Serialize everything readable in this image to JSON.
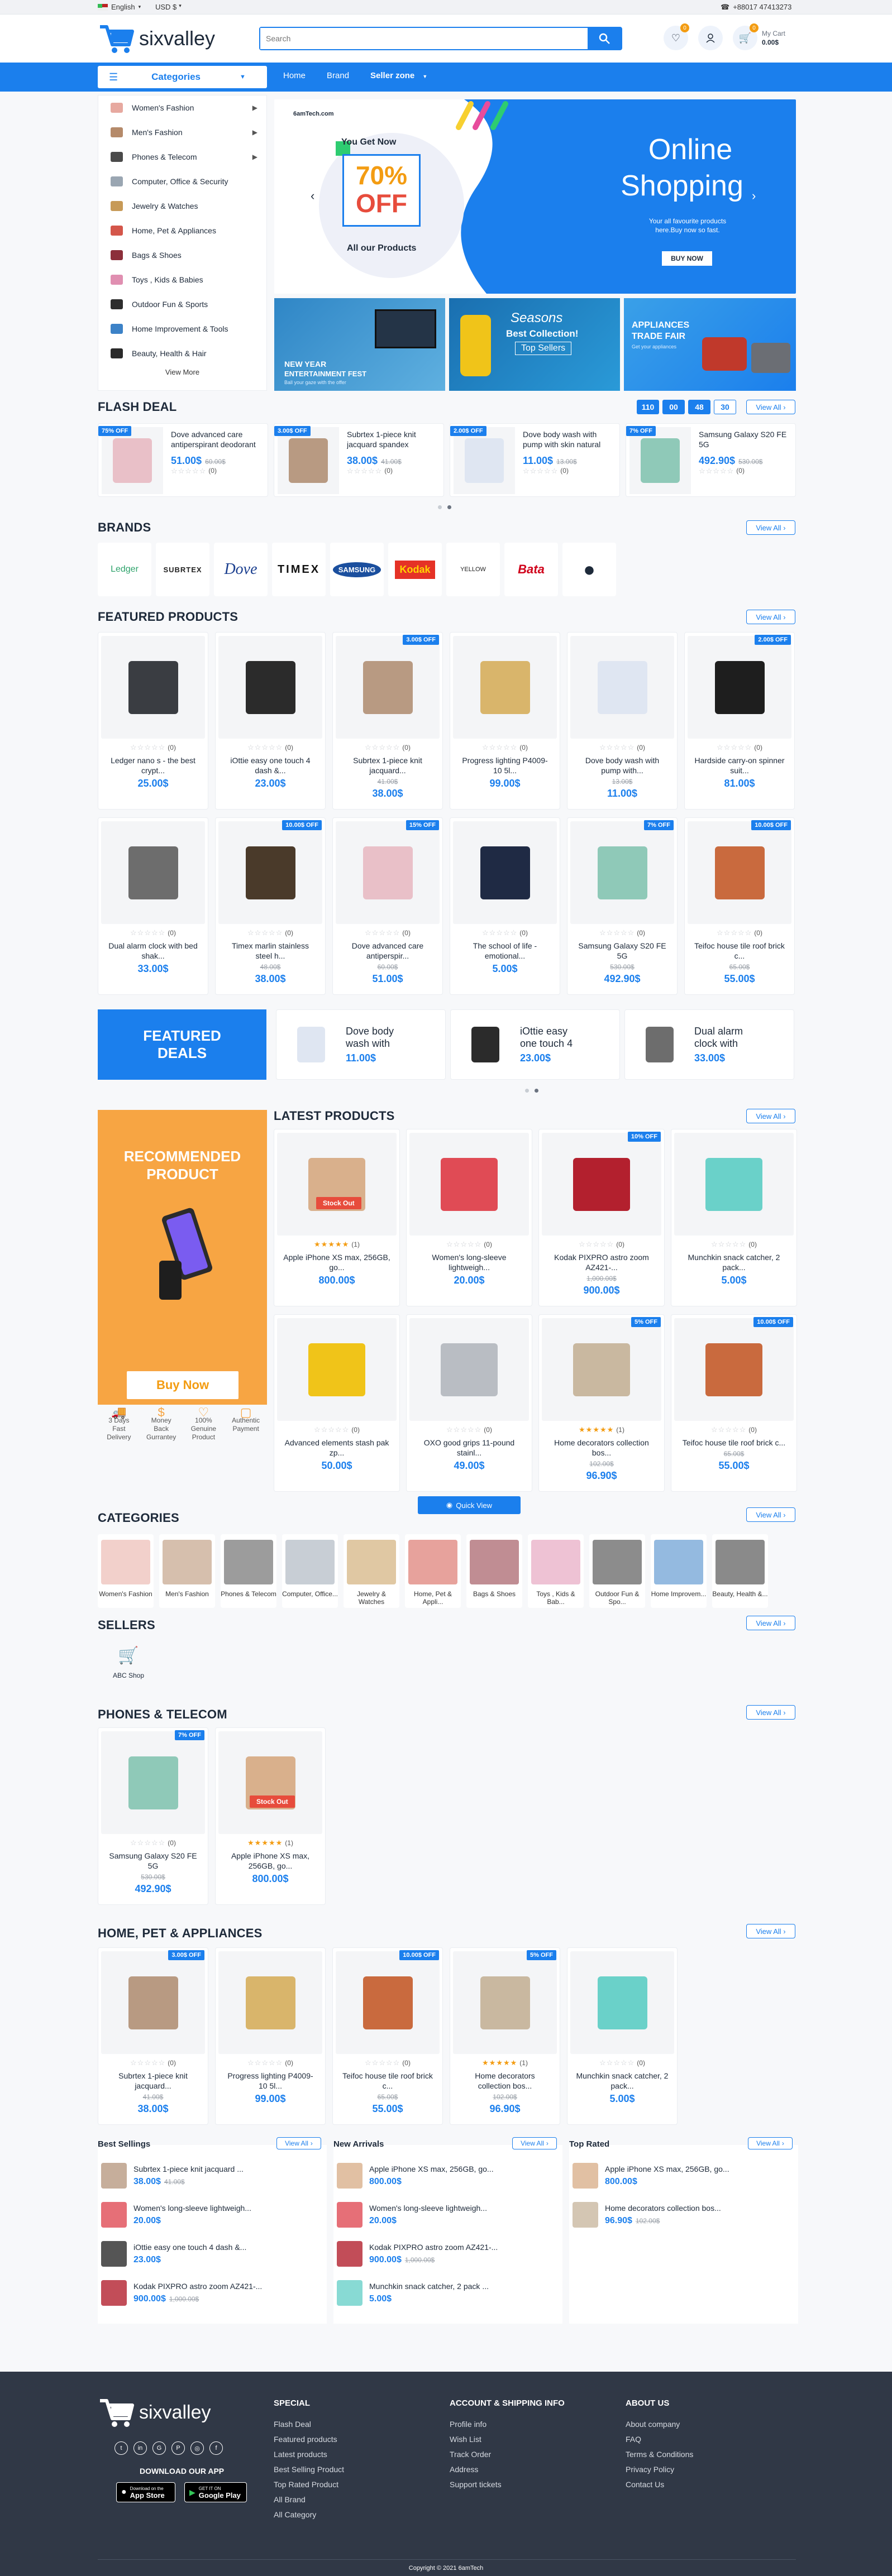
{
  "topbar": {
    "language": "English",
    "currency": "USD $",
    "phone": "+88017 47413273"
  },
  "header": {
    "logo": "sixvalley",
    "search_placeholder": "Search",
    "wishlist_count": "0",
    "compare_count": "0",
    "cart_label": "My Cart",
    "cart_total": "0.00$",
    "cart_count": "0"
  },
  "nav": {
    "categories_label": "Categories",
    "items": [
      "Home",
      "Brand",
      "Seller zone"
    ]
  },
  "sidebar": {
    "items": [
      {
        "label": "Women's Fashion",
        "color": "#e7a9a0",
        "arrow": true
      },
      {
        "label": "Men's Fashion",
        "color": "#b58a6a",
        "arrow": true
      },
      {
        "label": "Phones & Telecom",
        "color": "#4a4a4a",
        "arrow": true
      },
      {
        "label": "Computer, Office & Security",
        "color": "#9aa6b2",
        "arrow": false
      },
      {
        "label": "Jewelry & Watches",
        "color": "#c79a57",
        "arrow": false
      },
      {
        "label": "Home, Pet & Appliances",
        "color": "#d4564a",
        "arrow": false
      },
      {
        "label": "Bags & Shoes",
        "color": "#8c2f3a",
        "arrow": false
      },
      {
        "label": "Toys , Kids & Babies",
        "color": "#e08fb1",
        "arrow": false
      },
      {
        "label": "Outdoor Fun & Sports",
        "color": "#2d2d2d",
        "arrow": false
      },
      {
        "label": "Home Improvement & Tools",
        "color": "#3c82c7",
        "arrow": false
      },
      {
        "label": "Beauty, Health & Hair",
        "color": "#2a2a2a",
        "arrow": false
      }
    ],
    "view_more": "View More"
  },
  "hero": {
    "site": "6amTech.com",
    "you_get_now": "You Get Now",
    "discount": "70%",
    "off": "OFF",
    "all_products": "All our Products",
    "headline1": "Online",
    "headline2": "Shopping",
    "sub": "Your all favourite products here.Buy now so fast.",
    "cta": "BUY NOW"
  },
  "banners": [
    {
      "l1": "NEW YEAR",
      "l2": "ENTERTAINMENT FEST",
      "l3": "Ball your gaze with the offer"
    },
    {
      "l1": "Seasons",
      "l2": "Best Collection!",
      "l3": "Top Sellers"
    },
    {
      "l1": "APPLIANCES",
      "l2": "TRADE FAIR",
      "l3": "Get your appliances"
    }
  ],
  "flash_deal": {
    "title": "FLASH DEAL",
    "timer": [
      "110",
      "00",
      "48",
      "30"
    ],
    "view_all": "View All",
    "items": [
      {
        "badge": "75% OFF",
        "name": "Dove advanced care antiperspirant deodorant",
        "price": "51.00$",
        "old": "60.00$",
        "rating": "(0)",
        "color": "#e9c0c8"
      },
      {
        "badge": "3.00$ OFF",
        "name": "Subrtex 1-piece knit jacquard spandex stretch...",
        "price": "38.00$",
        "old": "41.00$",
        "rating": "(0)",
        "color": "#b89a82"
      },
      {
        "badge": "2.00$ OFF",
        "name": "Dove body wash with pump with skin natural",
        "price": "11.00$",
        "old": "13.00$",
        "rating": "(0)",
        "color": "#dfe6f2"
      },
      {
        "badge": "7% OFF",
        "name": "Samsung Galaxy S20 FE 5G",
        "price": "492.90$",
        "old": "530.00$",
        "rating": "(0)",
        "color": "#8fc9b8"
      }
    ]
  },
  "brands": {
    "title": "BRANDS",
    "view_all": "View All",
    "items": [
      "Ledger",
      "SUBRTEX",
      "Dove",
      "TIMEX",
      "SAMSUNG",
      "Kodak",
      "YELLOW",
      "Bata",
      "Apple"
    ]
  },
  "featured": {
    "title": "FEATURED PRODUCTS",
    "view_all": "View All",
    "items": [
      {
        "badge": "",
        "name": "Ledger nano s - the best crypt...",
        "price": "25.00$",
        "old": "",
        "color": "#3a3d42"
      },
      {
        "badge": "",
        "name": "iOttie easy one touch 4 dash &...",
        "price": "23.00$",
        "old": "",
        "color": "#2b2b2b"
      },
      {
        "badge": "3.00$ OFF",
        "name": "Subrtex 1-piece knit jacquard...",
        "price": "38.00$",
        "old": "41.00$",
        "color": "#b89a82"
      },
      {
        "badge": "",
        "name": "Progress lighting P4009-10 5l...",
        "price": "99.00$",
        "old": "",
        "color": "#d9b56b"
      },
      {
        "badge": "",
        "name": "Dove body wash with pump with...",
        "price": "11.00$",
        "old": "13.00$",
        "color": "#dfe6f2"
      },
      {
        "badge": "2.00$ OFF",
        "name": "Hardside carry-on spinner suit...",
        "price": "81.00$",
        "old": "",
        "color": "#1e1e1e"
      },
      {
        "badge": "",
        "name": "Dual alarm clock with bed shak...",
        "price": "33.00$",
        "old": "",
        "color": "#6d6d6d"
      },
      {
        "badge": "10.00$ OFF",
        "name": "Timex marlin stainless steel h...",
        "price": "38.00$",
        "old": "48.00$",
        "color": "#4a3a2a"
      },
      {
        "badge": "15% OFF",
        "name": "Dove advanced care antiperspir...",
        "price": "51.00$",
        "old": "60.00$",
        "color": "#e9c0c8"
      },
      {
        "badge": "",
        "name": "The school of life - emotional...",
        "price": "5.00$",
        "old": "",
        "color": "#1f2a44"
      },
      {
        "badge": "7% OFF",
        "name": "Samsung Galaxy S20 FE 5G",
        "price": "492.90$",
        "old": "530.00$",
        "color": "#8fc9b8"
      },
      {
        "badge": "10.00$ OFF",
        "name": "Teifoc house tile roof brick c...",
        "price": "55.00$",
        "old": "65.00$",
        "color": "#c96a3e"
      }
    ]
  },
  "featured_deals": {
    "title1": "FEATURED",
    "title2": "DEALS",
    "items": [
      {
        "name1": "Dove body",
        "name2": "wash with",
        "price": "11.00$",
        "color": "#dfe6f2"
      },
      {
        "name1": "iOttie easy",
        "name2": "one touch 4",
        "price": "23.00$",
        "color": "#2b2b2b"
      },
      {
        "name1": "Dual alarm",
        "name2": "clock with",
        "price": "33.00$",
        "color": "#6d6d6d"
      }
    ]
  },
  "recommended": {
    "title1": "RECOMMENDED",
    "title2": "PRODUCT",
    "cta": "Buy Now",
    "features": [
      {
        "l1": "3 Days",
        "l2": "Fast",
        "l3": "Delivery"
      },
      {
        "l1": "Money",
        "l2": "Back",
        "l3": "Gurrantey"
      },
      {
        "l1": "100%",
        "l2": "Genuine",
        "l3": "Product"
      },
      {
        "l1": "Authentic",
        "l2": "Payment",
        "l3": ""
      }
    ]
  },
  "latest": {
    "title": "LATEST PRODUCTS",
    "view_all": "View All",
    "quick_view": "Quick View",
    "items": [
      {
        "badge": "",
        "stock": "Stock Out",
        "name": "Apple iPhone XS max, 256GB, go...",
        "price": "800.00$",
        "old": "",
        "rated": true,
        "rating": "(1)",
        "color": "#d9b08c"
      },
      {
        "badge": "",
        "stock": "",
        "name": "Women's long-sleeve lightweigh...",
        "price": "20.00$",
        "old": "",
        "rated": false,
        "rating": "(0)",
        "color": "#e04b55"
      },
      {
        "badge": "10% OFF",
        "stock": "",
        "name": "Kodak PIXPRO astro zoom AZ421-...",
        "price": "900.00$",
        "old": "1,000.00$",
        "rated": false,
        "rating": "(0)",
        "color": "#b3202e"
      },
      {
        "badge": "",
        "stock": "",
        "name": "Munchkin snack catcher, 2 pack...",
        "price": "5.00$",
        "old": "",
        "rated": false,
        "rating": "(0)",
        "color": "#6ad1c9"
      },
      {
        "badge": "",
        "stock": "",
        "name": "Advanced elements stash pak zp...",
        "price": "50.00$",
        "old": "",
        "rated": false,
        "rating": "(0)",
        "color": "#f0c419"
      },
      {
        "badge": "",
        "stock": "",
        "name": "OXO good grips 11-pound stainl...",
        "price": "49.00$",
        "old": "",
        "rated": false,
        "rating": "(0)",
        "color": "#b9bdc3"
      },
      {
        "badge": "5% OFF",
        "stock": "",
        "name": "Home decorators collection bos...",
        "price": "96.90$",
        "old": "102.00$",
        "rated": true,
        "rating": "(1)",
        "color": "#c9b8a0"
      },
      {
        "badge": "10.00$ OFF",
        "stock": "",
        "name": "Teifoc house tile roof brick c...",
        "price": "55.00$",
        "old": "65.00$",
        "rated": false,
        "rating": "(0)",
        "color": "#c96a3e"
      }
    ]
  },
  "categories": {
    "title": "CATEGORIES",
    "view_all": "View All",
    "items": [
      {
        "label": "Women's Fashion",
        "color": "#e7a9a0"
      },
      {
        "label": "Men's Fashion",
        "color": "#b58a6a"
      },
      {
        "label": "Phones & Telecom",
        "color": "#4a4a4a"
      },
      {
        "label": "Computer, Office...",
        "color": "#9aa6b2"
      },
      {
        "label": "Jewelry & Watches",
        "color": "#c79a57"
      },
      {
        "label": "Home, Pet & Appli...",
        "color": "#d4564a"
      },
      {
        "label": "Bags & Shoes",
        "color": "#8c2f3a"
      },
      {
        "label": "Toys , Kids & Bab...",
        "color": "#e08fb1"
      },
      {
        "label": "Outdoor Fun & Spo...",
        "color": "#2d2d2d"
      },
      {
        "label": "Home Improvem...",
        "color": "#3c82c7"
      },
      {
        "label": "Beauty, Health &...",
        "color": "#2a2a2a"
      }
    ]
  },
  "sellers": {
    "title": "SELLERS",
    "view_all": "View All",
    "items": [
      {
        "name": "ABC Shop"
      }
    ]
  },
  "phones": {
    "title": "PHONES & TELECOM",
    "view_all": "View All",
    "items": [
      {
        "badge": "7% OFF",
        "stock": "",
        "name": "Samsung Galaxy S20 FE 5G",
        "price": "492.90$",
        "old": "530.00$",
        "rated": false,
        "rating": "(0)",
        "color": "#8fc9b8"
      },
      {
        "badge": "",
        "stock": "Stock Out",
        "name": "Apple iPhone XS max, 256GB, go...",
        "price": "800.00$",
        "old": "",
        "rated": true,
        "rating": "(1)",
        "color": "#d9b08c"
      }
    ]
  },
  "home_pet": {
    "title": "HOME, PET & APPLIANCES",
    "view_all": "View All",
    "items": [
      {
        "badge": "3.00$ OFF",
        "name": "Subrtex 1-piece knit jacquard...",
        "price": "38.00$",
        "old": "41.00$",
        "rated": false,
        "rating": "(0)",
        "color": "#b89a82"
      },
      {
        "badge": "",
        "name": "Progress lighting P4009-10 5l...",
        "price": "99.00$",
        "old": "",
        "rated": false,
        "rating": "(0)",
        "color": "#d9b56b"
      },
      {
        "badge": "10.00$ OFF",
        "name": "Teifoc house tile roof brick c...",
        "price": "55.00$",
        "old": "65.00$",
        "rated": false,
        "rating": "(0)",
        "color": "#c96a3e"
      },
      {
        "badge": "5% OFF",
        "name": "Home decorators collection bos...",
        "price": "96.90$",
        "old": "102.00$",
        "rated": true,
        "rating": "(1)",
        "color": "#c9b8a0"
      },
      {
        "badge": "",
        "name": "Munchkin snack catcher, 2 pack...",
        "price": "5.00$",
        "old": "",
        "rated": false,
        "rating": "(0)",
        "color": "#6ad1c9"
      }
    ]
  },
  "lists": [
    {
      "title": "Best Sellings",
      "view_all": "View All",
      "items": [
        {
          "name": "Subrtex 1-piece knit jacquard ...",
          "price": "38.00$",
          "old": "41.00$",
          "color": "#b89a82"
        },
        {
          "name": "Women's long-sleeve lightweigh...",
          "price": "20.00$",
          "old": "",
          "color": "#e04b55"
        },
        {
          "name": "iOttie easy one touch 4 dash &...",
          "price": "23.00$",
          "old": "",
          "color": "#2b2b2b"
        },
        {
          "name": "Kodak PIXPRO astro zoom AZ421-...",
          "price": "900.00$",
          "old": "1,000.00$",
          "color": "#b3202e"
        }
      ]
    },
    {
      "title": "New Arrivals",
      "view_all": "View All",
      "items": [
        {
          "name": "Apple iPhone XS max, 256GB, go...",
          "price": "800.00$",
          "old": "",
          "color": "#d9b08c"
        },
        {
          "name": "Women's long-sleeve lightweigh...",
          "price": "20.00$",
          "old": "",
          "color": "#e04b55"
        },
        {
          "name": "Kodak PIXPRO astro zoom AZ421-...",
          "price": "900.00$",
          "old": "1,000.00$",
          "color": "#b3202e"
        },
        {
          "name": "Munchkin snack catcher, 2 pack ...",
          "price": "5.00$",
          "old": "",
          "color": "#6ad1c9"
        }
      ]
    },
    {
      "title": "Top Rated",
      "view_all": "View All",
      "items": [
        {
          "name": "Apple iPhone XS max, 256GB, go...",
          "price": "800.00$",
          "old": "",
          "color": "#d9b08c"
        },
        {
          "name": "Home decorators collection bos...",
          "price": "96.90$",
          "old": "102.00$",
          "color": "#c9b8a0"
        }
      ]
    }
  ],
  "footer": {
    "logo": "sixvalley",
    "download": "DOWNLOAD OUR APP",
    "app_store_small": "Download on the",
    "app_store": "App Store",
    "play_small": "GET IT ON",
    "play": "Google Play",
    "cols": [
      {
        "title": "SPECIAL",
        "links": [
          "Flash Deal",
          "Featured products",
          "Latest products",
          "Best Selling Product",
          "Top Rated Product",
          "All Brand",
          "All Category"
        ]
      },
      {
        "title": "ACCOUNT & SHIPPING INFO",
        "links": [
          "Profile info",
          "Wish List",
          "Track Order",
          "Address",
          "Support tickets"
        ]
      },
      {
        "title": "ABOUT US",
        "links": [
          "About company",
          "FAQ",
          "Terms & Conditions",
          "Privacy Policy",
          "Contact Us"
        ]
      }
    ],
    "copyright": "Copyright © 2021 6amTech"
  }
}
